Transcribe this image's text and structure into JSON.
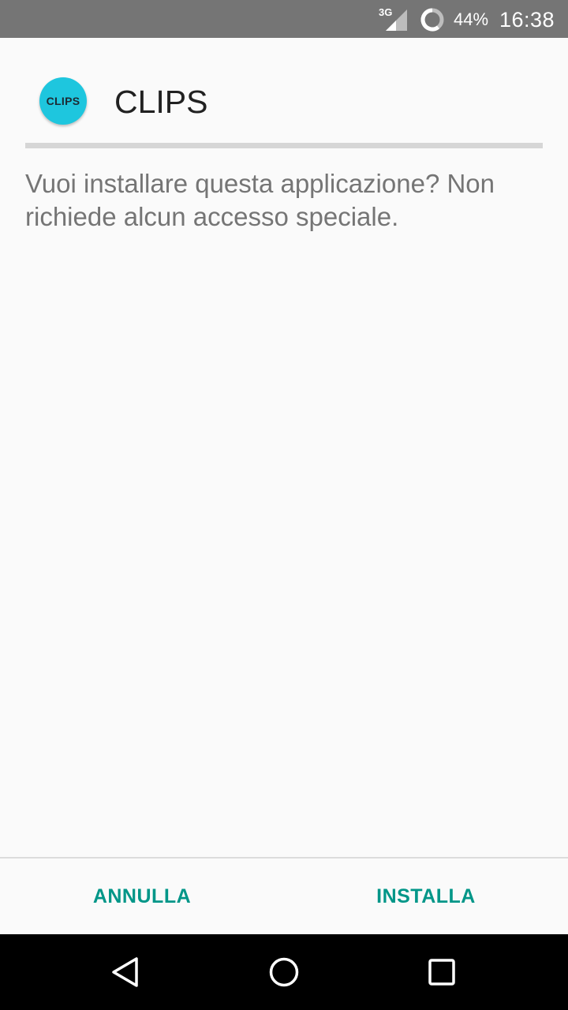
{
  "status_bar": {
    "network_type": "3G",
    "battery_percent": "44%",
    "time": "16:38",
    "icons": [
      "signal-icon",
      "battery-icon"
    ]
  },
  "app": {
    "icon_label": "CLIPS",
    "name": "CLIPS",
    "icon_color": "#1ec6de"
  },
  "message": "Vuoi installare questa applicazione? Non richiede alcun accesso speciale.",
  "buttons": {
    "cancel": "ANNULLA",
    "install": "INSTALLA",
    "accent_color": "#009688"
  },
  "nav_bar": {
    "icons": [
      "back-icon",
      "home-icon",
      "recents-icon"
    ]
  }
}
